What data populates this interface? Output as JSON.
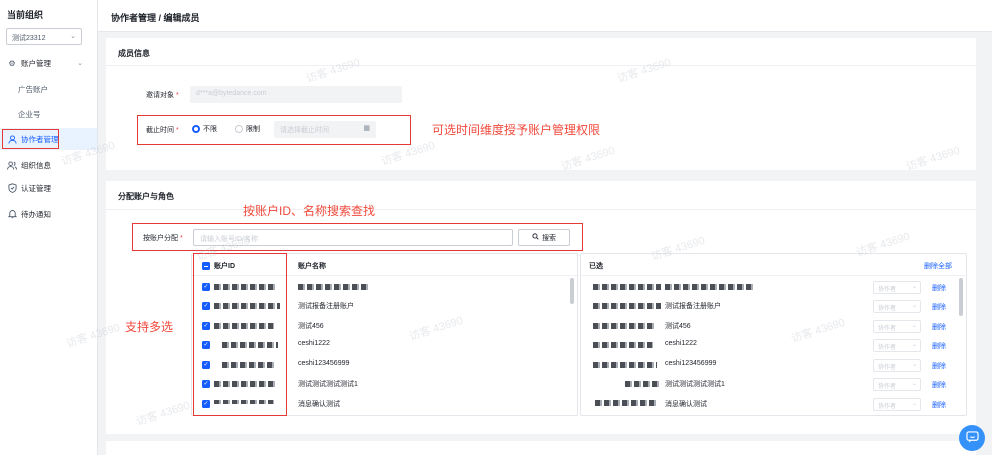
{
  "sidebar": {
    "org_title": "当前组织",
    "org_value": "测试23312",
    "items": [
      {
        "label": "账户管理"
      },
      {
        "label": "广告账户"
      },
      {
        "label": "企业号"
      },
      {
        "label": "协作者管理"
      },
      {
        "label": "组织信息"
      },
      {
        "label": "认证管理"
      },
      {
        "label": "待办通知"
      }
    ]
  },
  "header": {
    "breadcrumb": "协作者管理 / 编辑成员"
  },
  "member_info": {
    "title": "成员信息",
    "invite_label": "邀请对象",
    "invite_value": "d***a@bytedance.com",
    "deadline_label": "截止时间",
    "option_unlimited": "不限",
    "option_limited": "限制",
    "deadline_placeholder": "请选择截止时间"
  },
  "assign": {
    "title": "分配账户与角色",
    "by_account_label": "按账户分配",
    "search_placeholder": "请输入账号ID/名称",
    "search_button": "搜索"
  },
  "annotations": {
    "time_note": "可选时间维度授予账户管理权限",
    "search_note": "按账户ID、名称搜索查找",
    "multi_note": "支持多选"
  },
  "left_table": {
    "col_id": "账户ID",
    "col_name": "账户名称",
    "rows": [
      {
        "name": "",
        "checked": true
      },
      {
        "name": "测试报备注册账户",
        "checked": true
      },
      {
        "name": "测试456",
        "checked": true
      },
      {
        "name": "ceshi1222",
        "checked": true
      },
      {
        "name": "ceshi123456999",
        "checked": true
      },
      {
        "name": "测试测试测试测试1",
        "checked": true
      },
      {
        "name": "消息确认测试",
        "checked": true
      }
    ]
  },
  "right_table": {
    "title": "已选",
    "delete_all": "删除全部",
    "role_placeholder": "协作者",
    "delete_label": "删除",
    "rows": [
      {
        "name": ""
      },
      {
        "name": "测试报备注册账户"
      },
      {
        "name": "测试456"
      },
      {
        "name": "ceshi1222"
      },
      {
        "name": "ceshi123456999"
      },
      {
        "name": "测试测试测试测试1"
      },
      {
        "name": "消息确认测试"
      }
    ]
  },
  "watermark_text": "访客 43690",
  "colors": {
    "primary": "#165dff",
    "annotation": "#f04a3c",
    "highlight_box": "#e53935"
  }
}
